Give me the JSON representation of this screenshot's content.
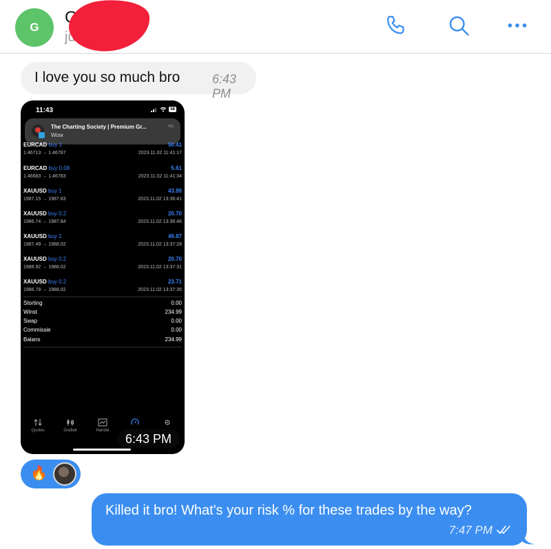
{
  "header": {
    "avatar_initial": "G",
    "contact_name": "Ge",
    "status": "just now",
    "icons": [
      "phone-icon",
      "search-icon",
      "more-icon"
    ]
  },
  "messages": {
    "incoming_text": "I love you so much bro",
    "incoming_time": "6:43 PM",
    "image_time": "6:43 PM",
    "reactions": [
      "🔥",
      "user-avatar"
    ],
    "outgoing_text": "Killed it bro! What's your risk % for these trades by the way?",
    "outgoing_time": "7:47 PM"
  },
  "screenshot": {
    "status_time": "11:43",
    "battery": "58",
    "notification": {
      "title": "The Charting Society | Premium Gr...",
      "body": "Wow",
      "time": "nu"
    },
    "trades": [
      {
        "symbol": "EURCAD",
        "action": "buy 1",
        "prices": "1.46713 → 1.46787",
        "profit": "50.41",
        "datetime": "2023.11.02 11:41:17"
      },
      {
        "symbol": "EURCAD",
        "action": "buy 0.08",
        "prices": "1.46683 → 1.46783",
        "profit": "5.61",
        "datetime": "2023.11.02 11:41:34"
      },
      {
        "symbol": "XAUUSD",
        "action": "buy 1",
        "prices": "1987.15 → 1987.83",
        "profit": "43.99",
        "datetime": "2023.11.02 13:36:41"
      },
      {
        "symbol": "XAUUSD",
        "action": "buy 0.2",
        "prices": "1986.74 → 1987.84",
        "profit": "20.70",
        "datetime": "2023.11.02 13:36:46"
      },
      {
        "symbol": "XAUUSD",
        "action": "buy 1",
        "prices": "1987.49 → 1988.02",
        "profit": "49.87",
        "datetime": "2023.11.02 13:37:28"
      },
      {
        "symbol": "XAUUSD",
        "action": "buy 0.2",
        "prices": "1986.92 → 1988.02",
        "profit": "20.70",
        "datetime": "2023.11.02 13:37:31"
      },
      {
        "symbol": "XAUUSD",
        "action": "buy 0.2",
        "prices": "1986.78 → 1988.02",
        "profit": "23.71",
        "datetime": "2023.11.02 13:37:35"
      }
    ],
    "summary": [
      {
        "label": "Storting",
        "value": "0.00"
      },
      {
        "label": "Winst",
        "value": "234.99"
      },
      {
        "label": "Swap",
        "value": "0.00"
      },
      {
        "label": "Commissie",
        "value": "0.00"
      },
      {
        "label": "Balans",
        "value": "234.99"
      }
    ],
    "tabs": [
      {
        "label": "Quotes",
        "icon": "quotes-icon"
      },
      {
        "label": "Grafiek",
        "icon": "chart-icon"
      },
      {
        "label": "Handel",
        "icon": "trade-icon"
      },
      {
        "label": "",
        "icon": "history-icon"
      },
      {
        "label": "",
        "icon": "settings-icon"
      }
    ]
  },
  "colors": {
    "accent": "#3b8ef0",
    "incoming_bubble": "#f1f1f1",
    "redaction": "#f2203a",
    "avatar": "#5ec46a",
    "profit_blue": "#3a82f6"
  }
}
